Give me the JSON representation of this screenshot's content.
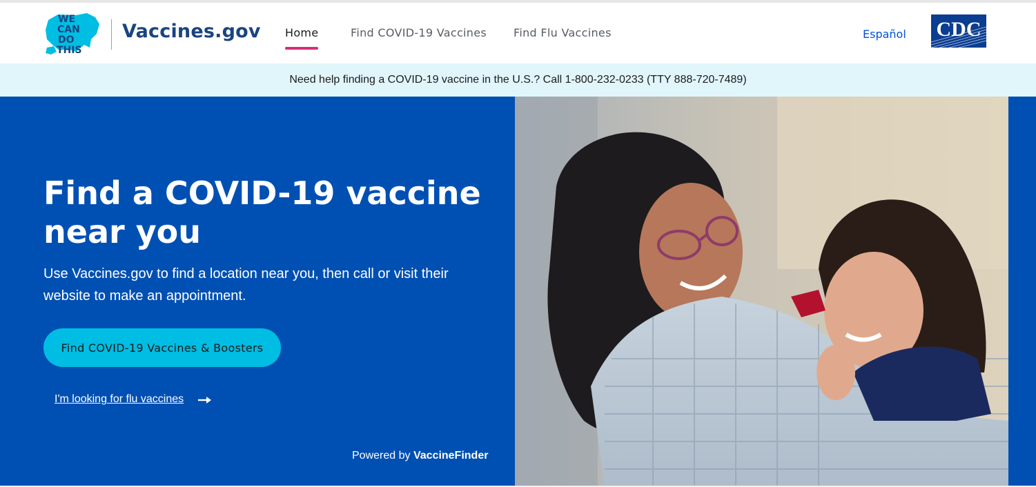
{
  "header": {
    "logo_lines": [
      "WE",
      "CAN",
      "DO",
      "THIS"
    ],
    "site_name": "Vaccines.gov",
    "nav": [
      {
        "label": "Home",
        "active": true
      },
      {
        "label": "Find COVID-19 Vaccines",
        "active": false
      },
      {
        "label": "Find Flu Vaccines",
        "active": false
      }
    ],
    "language_link": "Español",
    "agency_logo": "CDC"
  },
  "notice": {
    "text": "Need help finding a COVID-19 vaccine in the U.S.? Call 1-800-232-0233 (TTY 888-720-7489)"
  },
  "hero": {
    "title": "Find a COVID-19 vaccine near you",
    "subtitle": "Use Vaccines.gov to find a location near you, then call or visit their website to make an appointment.",
    "cta_label": "Find COVID-19 Vaccines & Boosters",
    "flu_link": "I'm looking for flu vaccines",
    "powered_prefix": "Powered by",
    "powered_brand": "VaccineFinder",
    "photo": "grandmother-and-child-photo"
  },
  "colors": {
    "brand_blue": "#1a4480",
    "hero_blue": "#0050b3",
    "cta_cyan": "#00bde3",
    "active_underline": "#d72d79",
    "notice_bg": "#e1f6fb"
  },
  "icons": [
    "us-map-logo-icon",
    "cdc-logo-icon",
    "arrow-right-icon"
  ]
}
